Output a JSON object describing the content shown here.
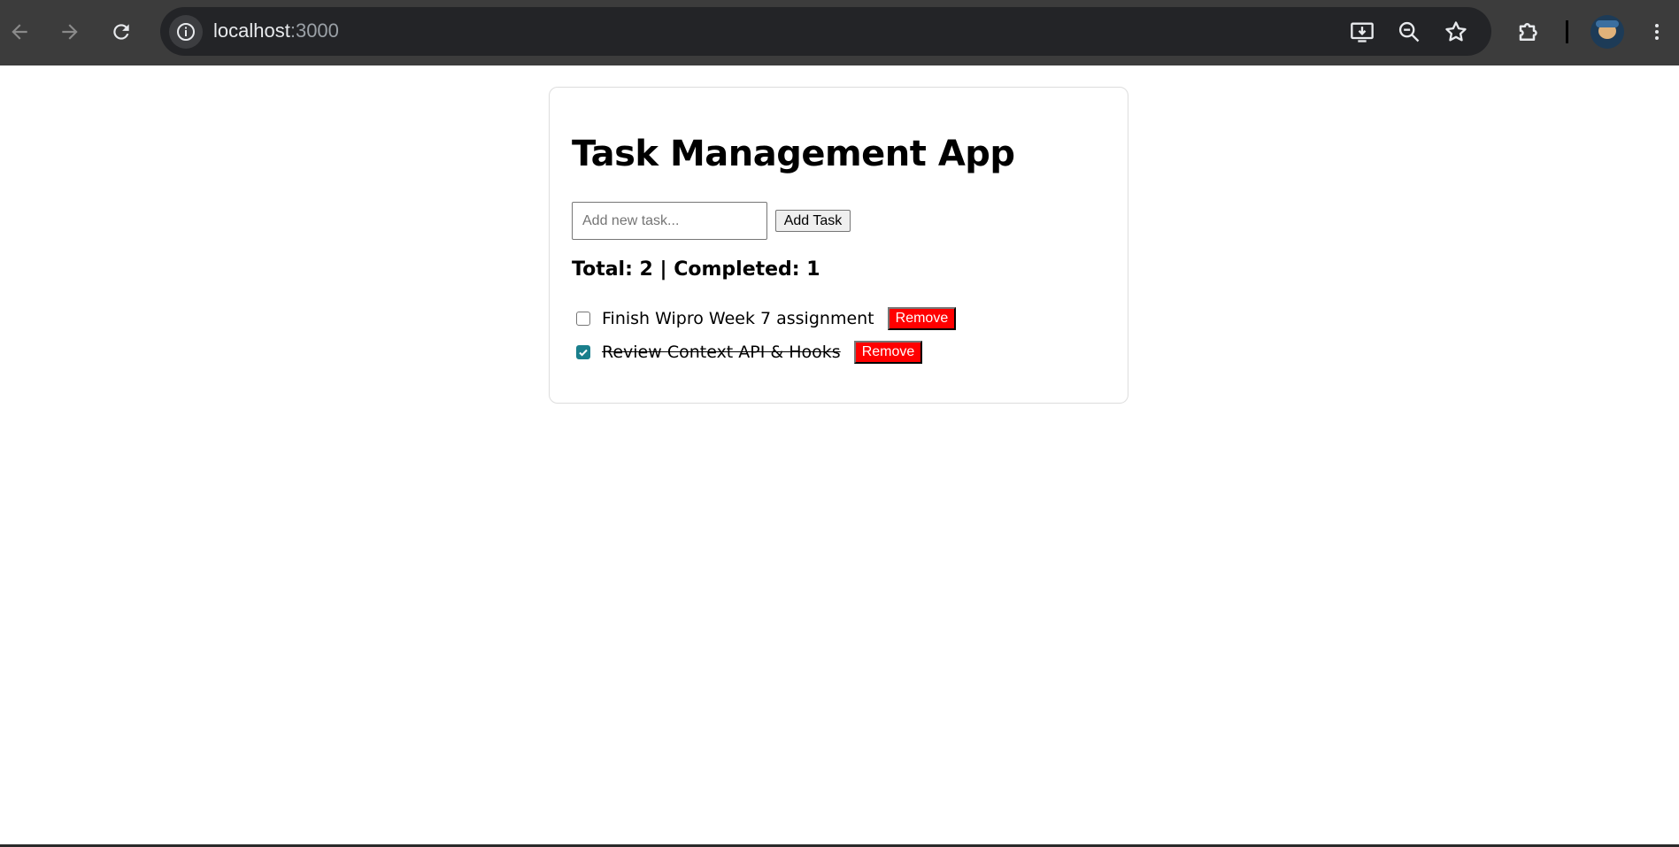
{
  "browser": {
    "url_host": "localhost",
    "url_port": ":3000"
  },
  "app": {
    "title": "Task Management App",
    "input_placeholder": "Add new task...",
    "input_value": "",
    "add_button_label": "Add Task",
    "stats": "Total: 2 | Completed: 1",
    "tasks": [
      {
        "text": "Finish Wipro Week 7 assignment",
        "completed": false,
        "remove_label": "Remove"
      },
      {
        "text": "Review Context API & Hooks",
        "completed": true,
        "remove_label": "Remove"
      }
    ]
  },
  "colors": {
    "chrome_bg": "#3c3c3c",
    "omnibox_bg": "#232427",
    "remove_button": "#ff0000",
    "checkbox_checked": "#1a7f8c"
  },
  "icons": {
    "back": "arrow-left-icon",
    "forward": "arrow-right-icon",
    "reload": "reload-icon",
    "site_info": "info-icon",
    "install": "install-app-icon",
    "zoom": "zoom-out-icon",
    "bookmark": "star-icon",
    "extensions": "puzzle-icon",
    "menu": "kebab-menu-icon"
  }
}
